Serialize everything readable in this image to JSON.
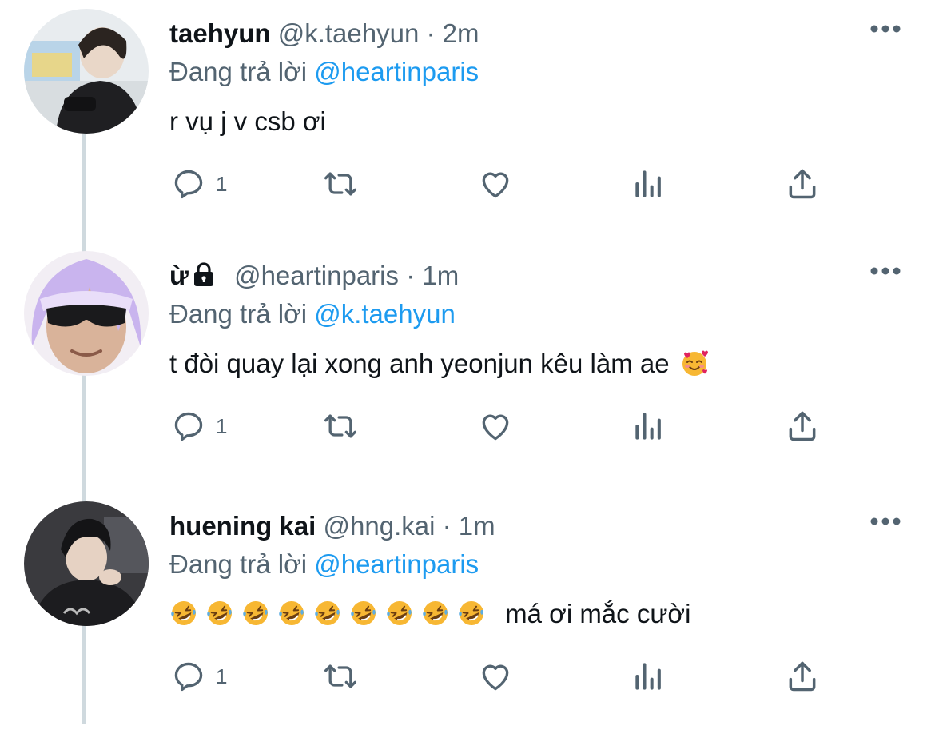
{
  "tweets": [
    {
      "name": "taehyun",
      "handle": "@k.taehyun",
      "sep": "·",
      "time": "2m",
      "reply_prefix": "Đang trả lời",
      "reply_to": "@heartinparis",
      "text": "r vụ j v csb ơi",
      "reply_count": "1",
      "locked": false
    },
    {
      "name": "ừ",
      "handle": "@heartinparis",
      "sep": "·",
      "time": "1m",
      "reply_prefix": "Đang trả lời",
      "reply_to": "@k.taehyun",
      "text": "t đòi quay lại xong anh yeonjun kêu làm ae",
      "reply_count": "1",
      "locked": true
    },
    {
      "name": "huening kai",
      "handle": "@hng.kai",
      "sep": "·",
      "time": "1m",
      "reply_prefix": "Đang trả lời",
      "reply_to": "@heartinparis",
      "text": "má ơi mắc cười",
      "reply_count": "1",
      "locked": false
    }
  ],
  "icons": {
    "reply": "reply-icon",
    "retweet": "retweet-icon",
    "like": "like-icon",
    "views": "analytics-icon",
    "share": "share-icon",
    "more": "more-icon",
    "lock": "lock-icon",
    "smiling_hearts": "smiling-face-with-hearts-emoji",
    "rofl": "rolling-on-floor-laughing-emoji"
  },
  "colors": {
    "text": "#0f1419",
    "secondary": "#536471",
    "link": "#1d9bf0",
    "thread_line": "#cfd9de"
  }
}
